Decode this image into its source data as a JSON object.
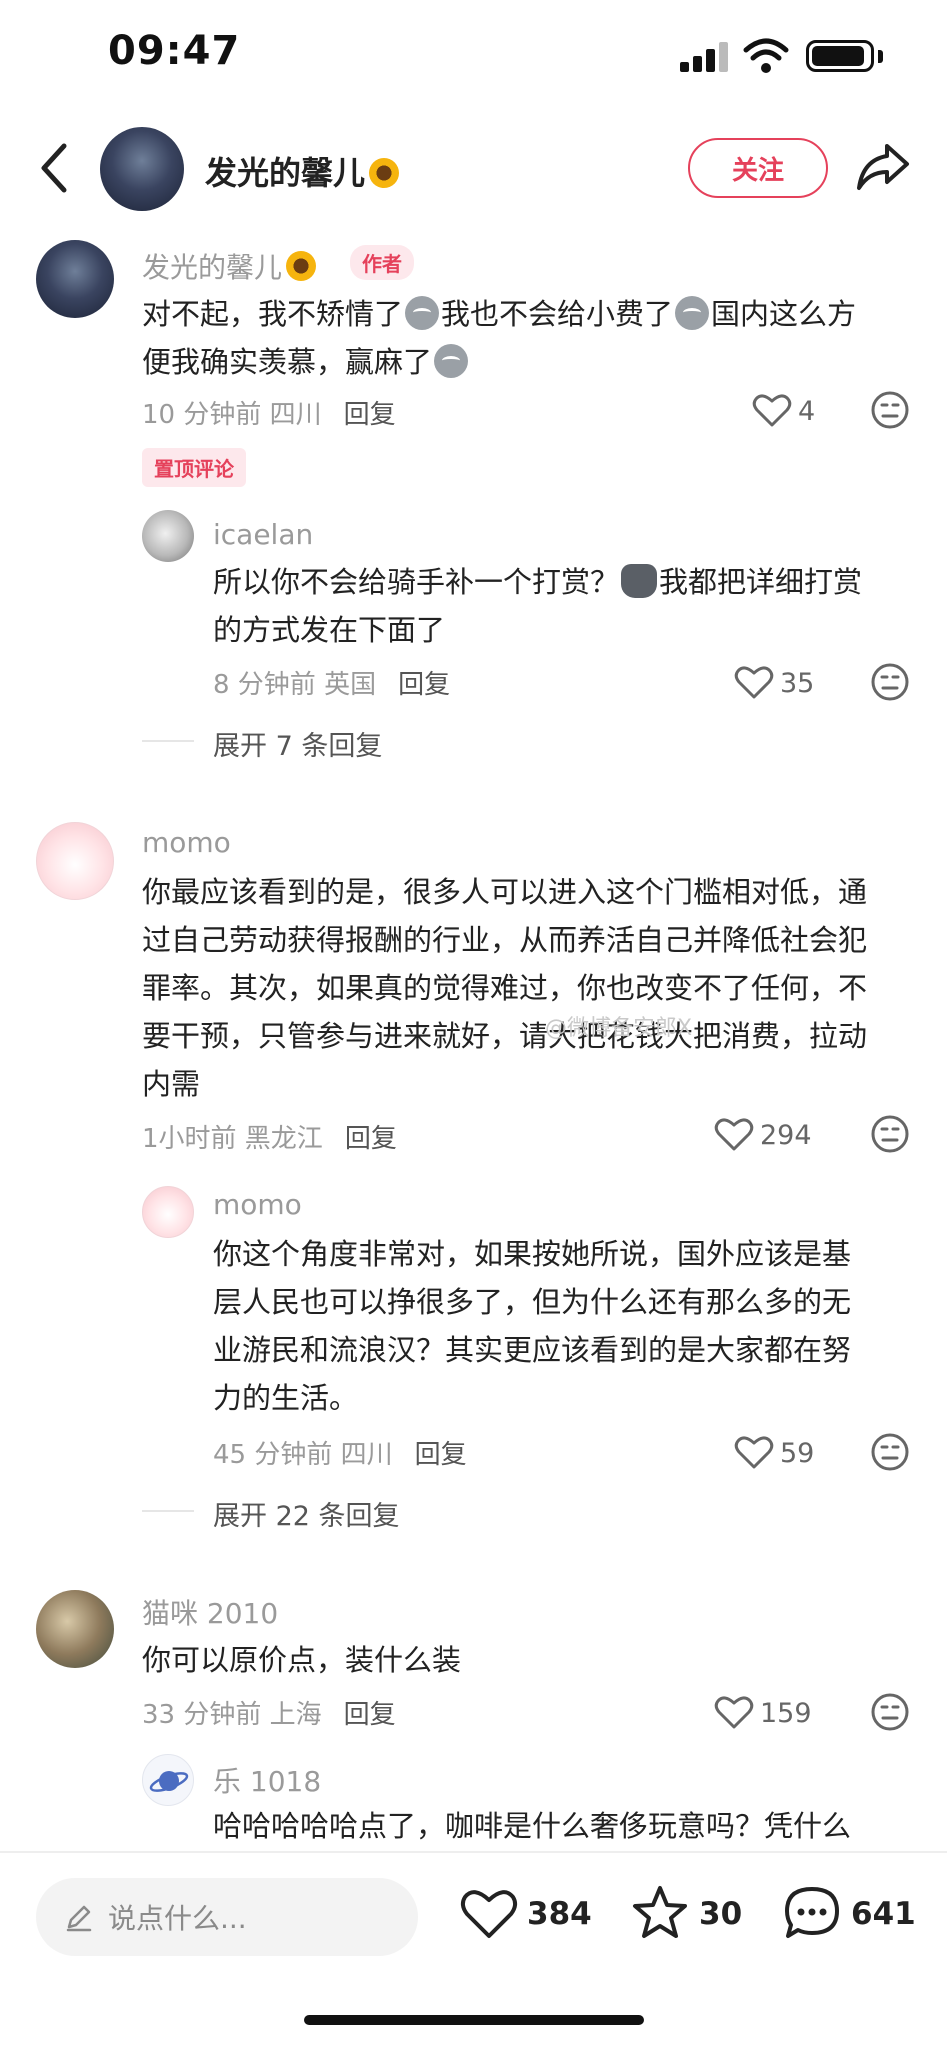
{
  "status_bar": {
    "time": "09:47"
  },
  "header": {
    "title": "发光的馨儿",
    "follow_label": "关注",
    "icons": [
      "back-arrow-icon",
      "share-icon",
      "sunflower-icon"
    ]
  },
  "comments": [
    {
      "user": "发光的馨儿",
      "author_tag": "作者",
      "text_line1a": "对不起，我不矫情了",
      "text_line1b": "我也不会给小费了",
      "text_line1c": "国内这么方",
      "text_line2a": "便我确实羡慕，赢麻了",
      "time_loc": "10 分钟前 四川",
      "reply_label": "回复",
      "likes": "4",
      "pin_tag": "置顶评论",
      "replies": [
        {
          "user": "icaelan",
          "text_line1a": "所以你不会给骑手补一个打赏？",
          "text_line1b": "我都把详细打赏",
          "text_line2": "的方式发在下面了",
          "time_loc": "8 分钟前 英国",
          "reply_label": "回复",
          "likes": "35"
        }
      ],
      "expand_label": "展开 7 条回复"
    },
    {
      "user": "momo",
      "lines": [
        "你最应该看到的是，很多人可以进入这个门槛相对低，通",
        "过自己劳动获得报酬的行业，从而养活自己并降低社会犯",
        "罪率。其次，如果真的觉得难过，你也改变不了任何，不",
        "要干预，只管参与进来就好，请大把花钱大把消费，拉动",
        "内需"
      ],
      "time_loc": "1小时前 黑龙江",
      "reply_label": "回复",
      "likes": "294",
      "replies": [
        {
          "user": "momo",
          "lines": [
            "你这个角度非常对，如果按她所说，国外应该是基",
            "层人民也可以挣很多了，但为什么还有那么多的无",
            "业游民和流浪汉？其实更应该看到的是大家都在努",
            "力的生活。"
          ],
          "time_loc": "45 分钟前 四川",
          "reply_label": "回复",
          "likes": "59"
        }
      ],
      "expand_label": "展开 22 条回复"
    },
    {
      "user": "猫咪 2010",
      "text": "你可以原价点，装什么装",
      "time_loc": "33 分钟前 上海",
      "reply_label": "回复",
      "likes": "159",
      "replies": [
        {
          "user": "乐 1018",
          "text": "哈哈哈哈哈点了，咖啡是什么奢侈玩意吗？凭什么"
        }
      ]
    }
  ],
  "bottom_bar": {
    "input_placeholder": "说点什么...",
    "likes": "384",
    "favorites": "30",
    "comments": "641"
  },
  "colors": {
    "accent": "#e5415b",
    "muted": "#9a9a9a",
    "tag_bg": "#fde8ec"
  }
}
